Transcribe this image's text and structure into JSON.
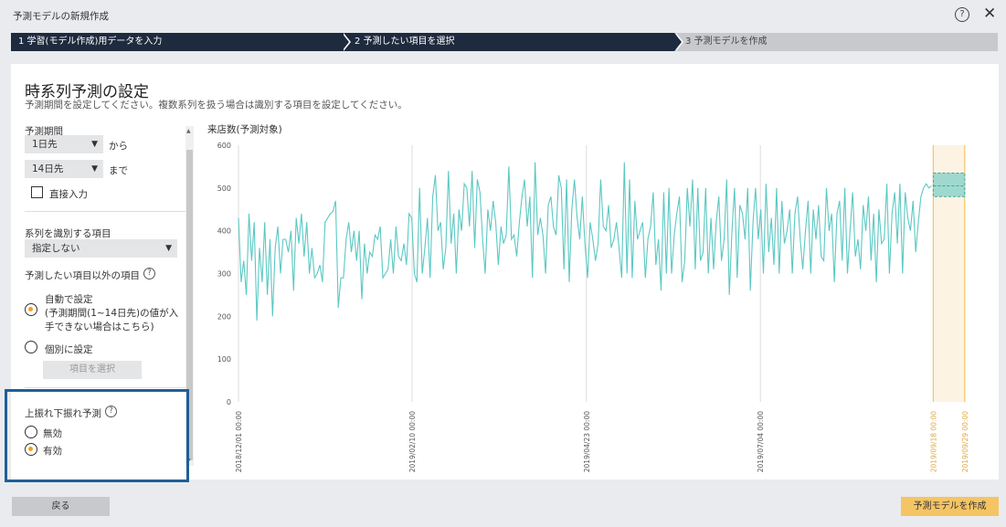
{
  "window": {
    "title": "予測モデルの新規作成",
    "help_glyph": "?",
    "close_glyph": "✕"
  },
  "steps": [
    {
      "label": "1 学習(モデル作成)用データを入力"
    },
    {
      "label": "2 予測したい項目を選択"
    },
    {
      "label": "3 予測モデルを作成"
    }
  ],
  "main": {
    "heading": "時系列予測の設定",
    "subtitle": "予測期間を設定してください。複数系列を扱う場合は識別する項目を設定してください。"
  },
  "left": {
    "period_label": "予測期間",
    "from_select": "1日先",
    "from_suffix": "から",
    "to_select": "14日先",
    "to_suffix": "まで",
    "direct_input": "直接入力",
    "series_label": "系列を識別する項目",
    "series_select": "指定しない",
    "other_items_label": "予測したい項目以外の項目",
    "auto_setting": "自動で設定",
    "auto_note1": "(予測期間(1~14日先)の値が入",
    "auto_note2": "手できない場合はこちら)",
    "individual_setting": "個別に設定",
    "select_items_button": "項目を選択",
    "updown_label": "上振れ下振れ予測",
    "disabled": "無効",
    "enabled": "有効"
  },
  "chart_data": {
    "type": "line",
    "title": "来店数(予測対象)",
    "ylim": [
      0,
      600
    ],
    "yticks": [
      0,
      100,
      200,
      300,
      400,
      500,
      600
    ],
    "xticks": [
      "2018/12/01 00:00",
      "2019/02/10 00:00",
      "2019/04/23 00:00",
      "2019/07/04 00:00",
      "2019/09/18 00:00",
      "2019/09/29 00:00"
    ],
    "forecast_region": {
      "start": "2019/09/18 00:00",
      "end": "2019/09/29 00:00",
      "center": 505,
      "upper": 535,
      "lower": 480
    },
    "series": [
      {
        "values": [
          430,
          280,
          330,
          250,
          440,
          330,
          420,
          190,
          360,
          280,
          420,
          250,
          380,
          200,
          360,
          410,
          300,
          380,
          380,
          350,
          400,
          260,
          430,
          370,
          440,
          340,
          420,
          300,
          360,
          290,
          300,
          320,
          280,
          420,
          430,
          440,
          445,
          470,
          220,
          290,
          290,
          380,
          420,
          350,
          400,
          330,
          400,
          240,
          370,
          300,
          350,
          340,
          390,
          380,
          410,
          290,
          300,
          310,
          380,
          300,
          410,
          340,
          330,
          370,
          320,
          440,
          430,
          300,
          280,
          500,
          300,
          360,
          430,
          290,
          480,
          530,
          400,
          420,
          310,
          360,
          540,
          370,
          440,
          300,
          450,
          400,
          510,
          500,
          410,
          540,
          360,
          520,
          490,
          380,
          300,
          450,
          400,
          470,
          420,
          320,
          410,
          370,
          390,
          550,
          380,
          390,
          340,
          420,
          480,
          520,
          410,
          480,
          290,
          560,
          390,
          430,
          390,
          300,
          460,
          480,
          410,
          390,
          530,
          500,
          310,
          520,
          280,
          450,
          520,
          430,
          380,
          480,
          370,
          290,
          420,
          380,
          330,
          370,
          520,
          410,
          400,
          460,
          360,
          380,
          420,
          360,
          290,
          560,
          300,
          520,
          290,
          470,
          380,
          400,
          420,
          290,
          380,
          410,
          490,
          320,
          380,
          260,
          490,
          300,
          500,
          300,
          390,
          440,
          480,
          280,
          330,
          500,
          410,
          520,
          310,
          500,
          330,
          350,
          500,
          300,
          430,
          310,
          420,
          480,
          330,
          380,
          520,
          250,
          400,
          500,
          290,
          460,
          440,
          380,
          500,
          260,
          420,
          500,
          380,
          450,
          300,
          510,
          350,
          430,
          320,
          500,
          300,
          470,
          370,
          400,
          450,
          300,
          440,
          480,
          380,
          310,
          400,
          470,
          300,
          450,
          380,
          460,
          340,
          330,
          500,
          400,
          440,
          280,
          440,
          470,
          330,
          500,
          300,
          400,
          490,
          340,
          380,
          310,
          460,
          400,
          480,
          330,
          440,
          280,
          450,
          370,
          380,
          510,
          300,
          440,
          490,
          370,
          510,
          300,
          490,
          430,
          400,
          470,
          350,
          420,
          480,
          500,
          510,
          500,
          505
        ]
      }
    ]
  },
  "buttons": {
    "back": "戻る",
    "create": "予測モデルを作成"
  },
  "colors": {
    "line": "#5bc8c3",
    "forecast_band": "#fdf3e3",
    "forecast_line": "#f5c464",
    "navy": "#1e2a3e",
    "highlight": "#1f5f97"
  }
}
